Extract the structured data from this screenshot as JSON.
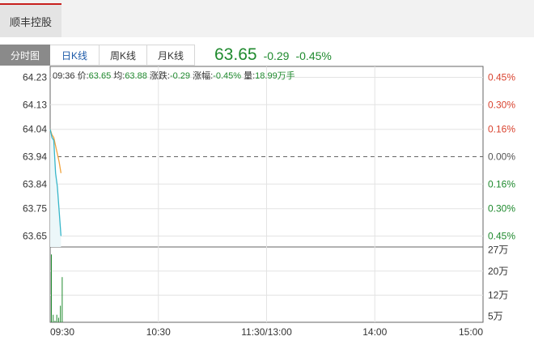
{
  "header": {
    "stock_name": "顺丰控股"
  },
  "tabs": [
    {
      "label": "分时图",
      "active": true
    },
    {
      "label": "日K线",
      "active": false
    },
    {
      "label": "周K线",
      "active": false
    },
    {
      "label": "月K线",
      "active": false
    }
  ],
  "quote": {
    "price": "63.65",
    "change": "-0.29",
    "change_pct": "-0.45%"
  },
  "info": {
    "time": "09:36",
    "price_label": "价:",
    "price": "63.65",
    "avg_label": "均:",
    "avg": "63.88",
    "change_label": "涨跌:",
    "change": "-0.29",
    "pct_label": "涨幅:",
    "pct": "-0.45%",
    "volume_label": "量:",
    "volume": "18.99万手"
  },
  "colors": {
    "up": "#d9432f",
    "down": "#1f8a2e",
    "price_line": "#38b6c9",
    "avg_line": "#f0a23c",
    "volume": "#1f8a2e"
  },
  "chart_data": {
    "type": "line",
    "price_axis": {
      "ylim": [
        63.61,
        64.27
      ],
      "ticks": [
        "64.23",
        "64.13",
        "64.04",
        "63.94",
        "63.84",
        "63.75",
        "63.65"
      ],
      "tick_values": [
        64.23,
        64.13,
        64.04,
        63.94,
        63.84,
        63.75,
        63.65
      ],
      "prev_close": 63.94
    },
    "pct_axis": {
      "ticks": [
        "0.45%",
        "0.30%",
        "0.16%",
        "0.00%",
        "0.16%",
        "0.30%",
        "0.45%"
      ],
      "tick_colors": [
        "up",
        "up",
        "up",
        "flat",
        "down",
        "down",
        "down"
      ]
    },
    "x_axis": {
      "ticks": [
        "09:30",
        "10:30",
        "11:30/13:00",
        "14:00",
        "15:00"
      ],
      "tick_minutes": [
        0,
        60,
        120,
        180,
        240
      ],
      "range_minutes": [
        0,
        240
      ]
    },
    "series": [
      {
        "name": "价",
        "x": [
          0,
          1,
          2,
          3,
          4,
          5,
          6
        ],
        "values": [
          64.04,
          64.01,
          64.0,
          63.88,
          63.83,
          63.74,
          63.65
        ]
      },
      {
        "name": "均",
        "x": [
          0,
          1,
          2,
          3,
          4,
          5,
          6
        ],
        "values": [
          64.04,
          64.02,
          64.01,
          63.98,
          63.95,
          63.92,
          63.88
        ]
      }
    ],
    "volume": {
      "ticks": [
        "27万",
        "20万",
        "12万",
        "5万"
      ],
      "tick_values": [
        27,
        20,
        12,
        5
      ],
      "ylim": [
        3,
        28
      ],
      "x": [
        0,
        1,
        2,
        3,
        4,
        5,
        6
      ],
      "values": [
        25.5,
        5.5,
        3.5,
        5.5,
        4.5,
        8.5,
        18.0
      ]
    }
  }
}
